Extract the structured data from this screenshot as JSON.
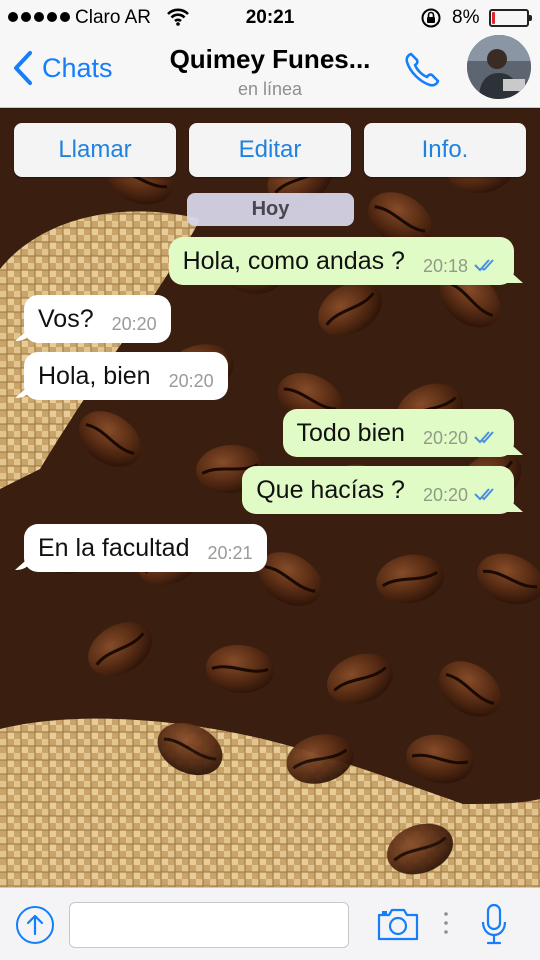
{
  "status_bar": {
    "carrier": "Claro AR",
    "time": "20:21",
    "battery_percent": "8%",
    "battery_level": 0.08,
    "signal_dots": 5
  },
  "nav": {
    "back_label": "Chats",
    "contact_name": "Quimey Funes...",
    "contact_status": "en línea"
  },
  "actions": [
    "Llamar",
    "Editar",
    "Info."
  ],
  "day_label": "Hoy",
  "messages": [
    {
      "direction": "out",
      "text": "Hola, como andas ?",
      "time": "20:18",
      "read": true
    },
    {
      "direction": "in",
      "text": "Vos?",
      "time": "20:20"
    },
    {
      "direction": "in",
      "text": "Hola, bien",
      "time": "20:20"
    },
    {
      "direction": "out",
      "text": "Todo bien",
      "time": "20:20",
      "read": true
    },
    {
      "direction": "out",
      "text": "Que hacías ?",
      "time": "20:20",
      "read": true
    },
    {
      "direction": "in",
      "text": "En la facultad",
      "time": "20:21"
    }
  ],
  "input": {
    "placeholder": "",
    "value": ""
  },
  "icons": {
    "wifi": "wifi-icon",
    "lock": "rotation-lock-icon",
    "back": "chevron-left-icon",
    "call": "phone-icon",
    "upload": "upload-circle-icon",
    "camera": "camera-icon",
    "mic": "microphone-icon",
    "read": "double-check-icon"
  },
  "colors": {
    "ios_blue": "#147efb",
    "out_bubble": "#e1fbc7",
    "in_bubble": "#ffffff",
    "read_tick": "#4a90e2",
    "battery_low": "#e0262b"
  }
}
